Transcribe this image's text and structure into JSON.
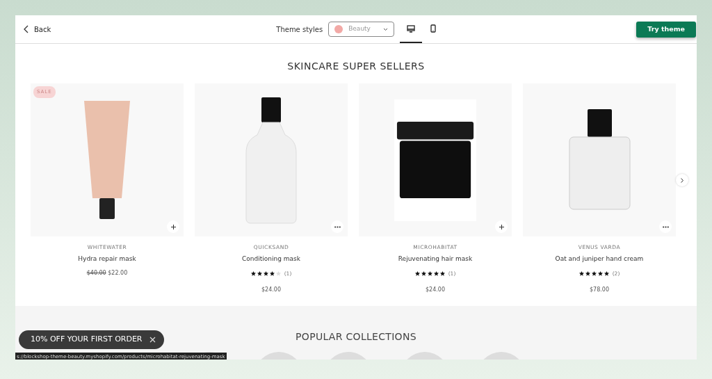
{
  "header": {
    "back": "Back",
    "theme_styles_label": "Theme styles",
    "theme_select": {
      "value": "Beauty",
      "color": "#f2a9a6"
    },
    "devices": [
      {
        "kind": "desktop",
        "selected": true
      },
      {
        "kind": "mobile",
        "selected": false
      }
    ],
    "try_button": "Try theme"
  },
  "section_title": "SKINCARE SUPER SELLERS",
  "products": [
    {
      "kind": "tube",
      "badge": "SALE",
      "corner_button": {
        "kind": "plus"
      },
      "vendor": "WHITEWATER",
      "name": "Hydra repair mask",
      "compare_price": "$40.00",
      "price": "$22.00"
    },
    {
      "kind": "bottle",
      "corner_button": {
        "kind": "more"
      },
      "vendor": "QUICKSAND",
      "name": "Conditioning mask",
      "stars": 4,
      "review_count": "(1)",
      "price": "$24.00"
    },
    {
      "kind": "jar",
      "corner_button": {
        "kind": "plus"
      },
      "vendor": "MICROHABITAT",
      "name": "Rejuvenating hair mask",
      "stars": 5,
      "review_count": "(1)",
      "price": "$24.00"
    },
    {
      "kind": "flacon",
      "corner_button": {
        "kind": "more"
      },
      "vendor": "VENUS VARDA",
      "name": "Oat and juniper hand cream",
      "stars": 5,
      "review_count": "(2)",
      "price": "$78.00"
    }
  ],
  "collections_title": "POPULAR COLLECTIONS",
  "promo": "10% OFF YOUR FIRST ORDER",
  "status_url": "s://blockshop-theme-beauty.myshopify.com/products/microhabitat-rejuvenating-mask"
}
